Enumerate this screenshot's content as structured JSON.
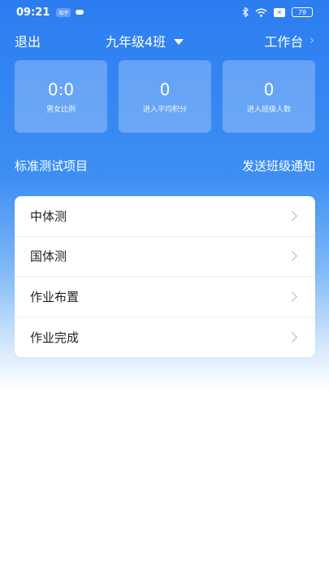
{
  "status_bar": {
    "time": "09:21",
    "app_badge": "知乎",
    "battery": "79",
    "icons": [
      "bluetooth-icon",
      "wifi-icon",
      "x-icon",
      "battery-icon"
    ]
  },
  "header": {
    "exit_label": "退出",
    "class_name": "九年级4班",
    "workbench_label": "工作台"
  },
  "stats": [
    {
      "value": "0:0",
      "label": "男女比例"
    },
    {
      "value": "0",
      "label": "进入平均积分"
    },
    {
      "value": "0",
      "label": "进入班级人数"
    }
  ],
  "section": {
    "title": "标准测试项目",
    "action": "发送班级通知"
  },
  "menu": [
    {
      "label": "中体测"
    },
    {
      "label": "国体测"
    },
    {
      "label": "作业布置"
    },
    {
      "label": "作业完成"
    }
  ],
  "colors": {
    "primary": "#2c7df0",
    "card_bg": "#ffffff"
  }
}
